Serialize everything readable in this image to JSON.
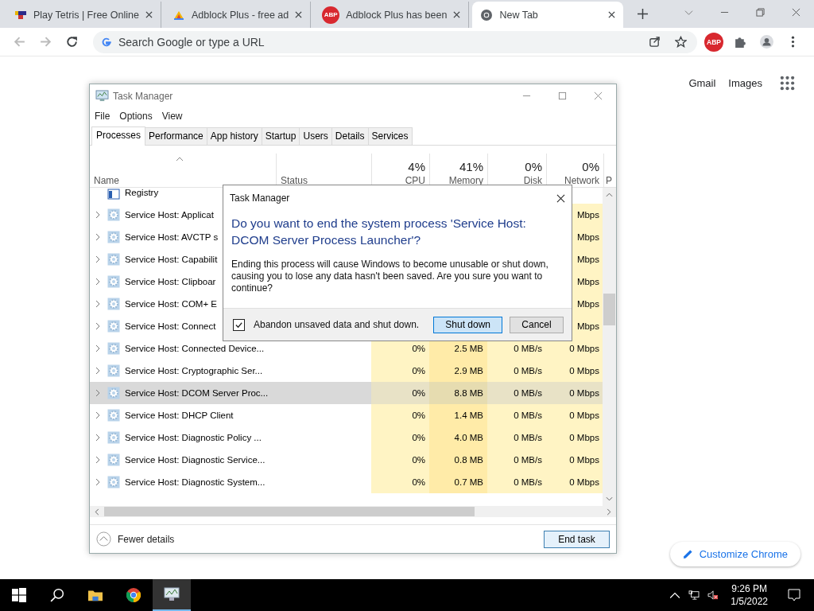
{
  "browser": {
    "tabs": [
      {
        "title": "Play Tetris | Free Online",
        "kind": "tetris",
        "selected": false
      },
      {
        "title": "Adblock Plus - free ad",
        "kind": "colorful",
        "selected": false
      },
      {
        "title": "Adblock Plus has been",
        "kind": "abp",
        "icon_text": "ABP",
        "selected": false
      },
      {
        "title": "New Tab",
        "kind": "chrome",
        "selected": true
      }
    ],
    "omnibox": {
      "placeholder": "Search Google or type a URL"
    },
    "extension_badge": "ABP"
  },
  "new_tab_page": {
    "links": [
      "Gmail",
      "Images"
    ],
    "customize_button": "Customize Chrome"
  },
  "task_manager": {
    "title": "Task Manager",
    "menu": [
      "File",
      "Options",
      "View"
    ],
    "tabs": [
      {
        "label": "Processes",
        "selected": true
      },
      {
        "label": "Performance",
        "selected": false
      },
      {
        "label": "App history",
        "selected": false
      },
      {
        "label": "Startup",
        "selected": false
      },
      {
        "label": "Users",
        "selected": false
      },
      {
        "label": "Details",
        "selected": false
      },
      {
        "label": "Services",
        "selected": false
      }
    ],
    "columns": [
      {
        "label": "Name"
      },
      {
        "label": "Status"
      },
      {
        "percent": "4%",
        "label": "CPU"
      },
      {
        "percent": "41%",
        "label": "Memory"
      },
      {
        "percent": "0%",
        "label": "Disk"
      },
      {
        "percent": "0%",
        "label": "Network"
      },
      {
        "label": "P"
      }
    ],
    "rows": [
      {
        "kind": "registry",
        "name": "Registry",
        "selected": false
      },
      {
        "kind": "service",
        "name": "Service Host: Applicat",
        "network": "Mbps",
        "selected": false
      },
      {
        "kind": "service",
        "name": "Service Host: AVCTP s",
        "network": "Mbps",
        "selected": false
      },
      {
        "kind": "service",
        "name": "Service Host: Capabilit",
        "network": "Mbps",
        "selected": false
      },
      {
        "kind": "service",
        "name": "Service Host: Clipboar",
        "network": "Mbps",
        "selected": false
      },
      {
        "kind": "service",
        "name": "Service Host: COM+ E",
        "network": "Mbps",
        "selected": false
      },
      {
        "kind": "service",
        "name": "Service Host: Connect",
        "network": "Mbps",
        "selected": false
      },
      {
        "kind": "service",
        "name": "Service Host: Connected Device...",
        "cpu": "0%",
        "memory": "2.5 MB",
        "disk": "0 MB/s",
        "network": "0 Mbps",
        "selected": false
      },
      {
        "kind": "service",
        "name": "Service Host: Cryptographic Ser...",
        "cpu": "0%",
        "memory": "2.9 MB",
        "disk": "0 MB/s",
        "network": "0 Mbps",
        "selected": false
      },
      {
        "kind": "service",
        "name": "Service Host: DCOM Server Proc...",
        "cpu": "0%",
        "memory": "8.8 MB",
        "disk": "0 MB/s",
        "network": "0 Mbps",
        "selected": true
      },
      {
        "kind": "service",
        "name": "Service Host: DHCP Client",
        "cpu": "0%",
        "memory": "1.4 MB",
        "disk": "0 MB/s",
        "network": "0 Mbps",
        "selected": false
      },
      {
        "kind": "service",
        "name": "Service Host: Diagnostic Policy ...",
        "cpu": "0%",
        "memory": "4.0 MB",
        "disk": "0 MB/s",
        "network": "0 Mbps",
        "selected": false
      },
      {
        "kind": "service",
        "name": "Service Host: Diagnostic Service...",
        "cpu": "0%",
        "memory": "0.8 MB",
        "disk": "0 MB/s",
        "network": "0 Mbps",
        "selected": false
      },
      {
        "kind": "service",
        "name": "Service Host: Diagnostic System...",
        "cpu": "0%",
        "memory": "0.7 MB",
        "disk": "0 MB/s",
        "network": "0 Mbps",
        "selected": false
      }
    ],
    "footer": {
      "fewer_details": "Fewer details",
      "end_task": "End task"
    }
  },
  "dialog": {
    "title": "Task Manager",
    "question": "Do you want to end the system process 'Service Host: DCOM Server Process Launcher'?",
    "message": "Ending this process will cause Windows to become unusable or shut down, causing you to lose any data hasn't been saved. Are you sure you want to continue?",
    "checkbox": {
      "label": "Abandon unsaved data and shut down.",
      "checked": true
    },
    "buttons": [
      {
        "label": "Shut down",
        "default": true
      },
      {
        "label": "Cancel",
        "default": false
      }
    ]
  },
  "taskbar": {
    "time": "9:26 PM",
    "date": "1/5/2022"
  }
}
